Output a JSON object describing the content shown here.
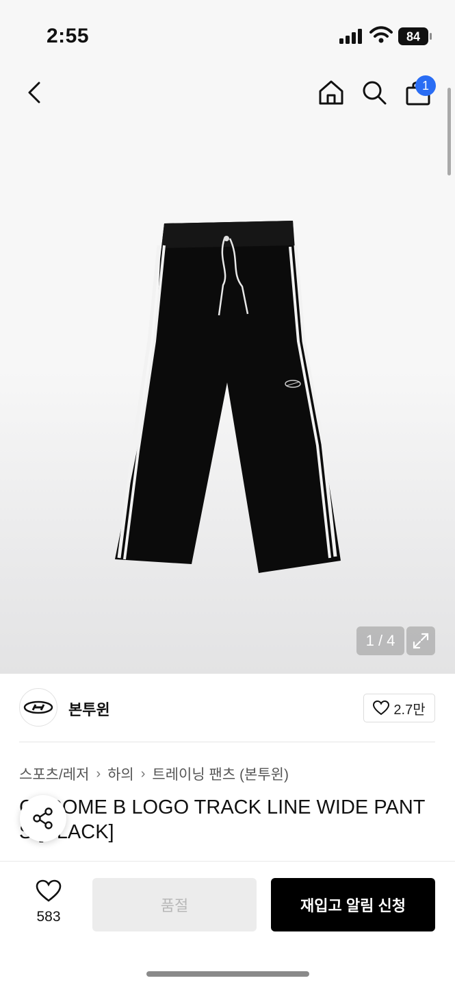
{
  "status_bar": {
    "time": "2:55",
    "battery": "84"
  },
  "nav": {
    "cart_count": "1"
  },
  "gallery": {
    "counter": "1 / 4"
  },
  "brand": {
    "name": "본투윈",
    "like_count": "2.7만"
  },
  "breadcrumb": [
    "스포츠/레저",
    "하의",
    "트레이닝 팬츠 (본투윈)"
  ],
  "product": {
    "title": "CHROME B LOGO TRACK LINE WIDE PANTS [BLACK]"
  },
  "bottom_bar": {
    "wish_count": "583",
    "soldout_label": "품절",
    "restock_label": "재입고 알림 신청"
  },
  "colors": {
    "accent_badge": "#2a6df4",
    "primary_button": "#000000",
    "disabled_button": "#ececec"
  }
}
